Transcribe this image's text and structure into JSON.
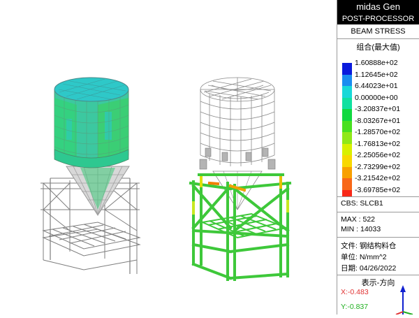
{
  "panel": {
    "app_title": "midas Gen",
    "mode": "POST-PROCESSOR",
    "result_type": "BEAM STRESS",
    "combination_label": "组合(最大值)",
    "legend": [
      {
        "value": "1.60888e+02",
        "color": "#0a1adc"
      },
      {
        "value": "1.12645e+02",
        "color": "#1a8cf0"
      },
      {
        "value": "6.44023e+01",
        "color": "#18d8d8"
      },
      {
        "value": "0.00000e+00",
        "color": "#10e0a0"
      },
      {
        "value": "-3.20837e+01",
        "color": "#10d840"
      },
      {
        "value": "-8.03267e+01",
        "color": "#48e020"
      },
      {
        "value": "-1.28570e+02",
        "color": "#90e818"
      },
      {
        "value": "-1.76813e+02",
        "color": "#d8f000"
      },
      {
        "value": "-2.25056e+02",
        "color": "#f8d800"
      },
      {
        "value": "-2.73299e+02",
        "color": "#f8a000"
      },
      {
        "value": "-3.21542e+02",
        "color": "#f86818"
      },
      {
        "value": "-3.69785e+02",
        "color": "#f82818"
      }
    ],
    "cbs": "CBS: SLCB1",
    "max": "MAX : 522",
    "min": "MIN : 14033",
    "file_label": "文件:",
    "file_value": "钢结构料仓",
    "unit_label": "单位:",
    "unit_value": "N/mm^2",
    "date_label": "日期:",
    "date_value": "04/26/2022",
    "view_direction": "表示-方向",
    "axis_x": "X:-0.483",
    "axis_y": "Y:-0.837"
  },
  "colors": {
    "model_green": "#3ec83a",
    "model_teal": "#3cc8a0",
    "wire_grey": "#8a8a8a"
  }
}
